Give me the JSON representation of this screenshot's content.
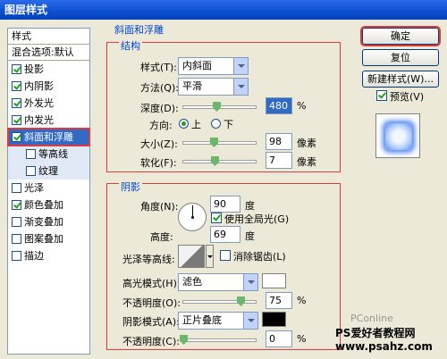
{
  "window": {
    "title": "图层样式"
  },
  "style_list": {
    "header": "样式",
    "blend_option": "混合选项:默认",
    "items": [
      {
        "label": "投影",
        "checked": true
      },
      {
        "label": "内阴影",
        "checked": true
      },
      {
        "label": "外发光",
        "checked": true
      },
      {
        "label": "内发光",
        "checked": true
      },
      {
        "label": "斜面和浮雕",
        "checked": true,
        "selected": true
      },
      {
        "label": "等高线",
        "checked": false,
        "sub": true
      },
      {
        "label": "纹理",
        "checked": false,
        "sub": true
      },
      {
        "label": "光泽",
        "checked": false
      },
      {
        "label": "颜色叠加",
        "checked": true
      },
      {
        "label": "渐变叠加",
        "checked": false
      },
      {
        "label": "图案叠加",
        "checked": false
      },
      {
        "label": "描边",
        "checked": false
      }
    ]
  },
  "bevel": {
    "section_title": "斜面和浮雕",
    "structure_title": "结构",
    "style_label": "样式(T):",
    "style_value": "内斜面",
    "technique_label": "方法(Q):",
    "technique_value": "平滑",
    "depth_label": "深度(D):",
    "depth_value": "480",
    "depth_unit": "%",
    "direction_label": "方向:",
    "direction_up": "上",
    "direction_down": "下",
    "size_label": "大小(Z):",
    "size_value": "98",
    "size_unit": "像素",
    "soften_label": "软化(F):",
    "soften_value": "7",
    "soften_unit": "像素"
  },
  "shading": {
    "title": "阴影",
    "angle_label": "角度(N):",
    "angle_value": "90",
    "angle_unit": "度",
    "global_light_label": "使用全局光(G)",
    "altitude_label": "高度:",
    "altitude_value": "69",
    "altitude_unit": "度",
    "gloss_contour_label": "光泽等高线:",
    "anti_alias_label": "消除锯齿(L)",
    "highlight_mode_label": "高光模式(H):",
    "highlight_mode_value": "滤色",
    "highlight_opacity_label": "不透明度(O):",
    "highlight_opacity_value": "75",
    "highlight_opacity_unit": "%",
    "shadow_mode_label": "阴影模式(A):",
    "shadow_mode_value": "正片叠底",
    "shadow_opacity_label": "不透明度(C):",
    "shadow_opacity_value": "0",
    "shadow_opacity_unit": "%",
    "highlight_color": "#ffffff",
    "shadow_color": "#000000"
  },
  "buttons": {
    "ok": "确定",
    "reset": "复位",
    "new_style": "新建样式(W)...",
    "preview_label": "预览(V)"
  },
  "watermarks": {
    "pconline": "PConline",
    "brand_line1": "PS爱好者教程网",
    "brand_line2": "www.psahz.com"
  }
}
